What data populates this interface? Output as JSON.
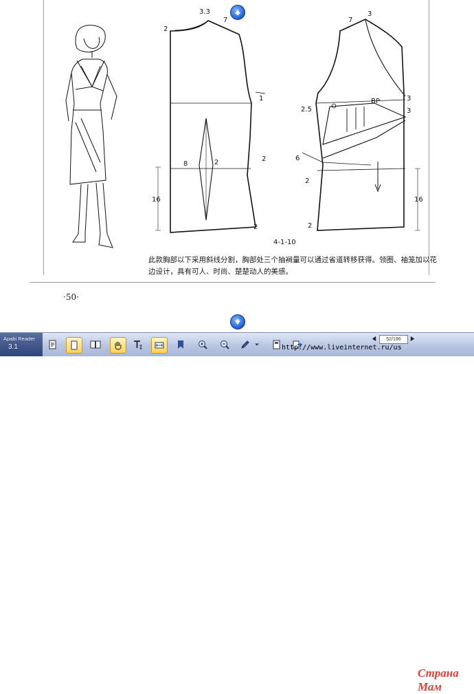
{
  "document": {
    "figure_caption": "4-1-10",
    "body_text": "此款胸部以下采用斜线分割，胸部处三个抽裥量可以通过省道转移获得。领圈、袖笼加以花边设计，具有可人、时尚、楚楚动人的美感。",
    "page_number": "·50·",
    "front_pattern_labels": {
      "neck_width": "3.3",
      "shoulder": "7",
      "neck_drop": "2",
      "armhole": "1",
      "waist_left": "8",
      "waist_dart": "2",
      "side": "2",
      "hip_depth": "16",
      "hem": "2"
    },
    "back_pattern_labels": {
      "shoulder": "7",
      "neck": "3",
      "bp": "BP",
      "apex_top": "3",
      "apex_bottom": "3",
      "offset": "2.5",
      "diagonal": "6",
      "side": "2",
      "hip_depth": "16",
      "hem": "2"
    }
  },
  "toolbar": {
    "app_name": "Apabi Reader",
    "app_version": "3.1",
    "url": "http://www.liveinternet.ru/us",
    "page_field": "52/196",
    "watermark": "Страна Мам",
    "buttons": [
      {
        "name": "open-file-icon"
      },
      {
        "name": "single-page-icon",
        "active": true
      },
      {
        "name": "two-page-icon"
      },
      {
        "name": "hand-tool-icon",
        "active": true
      },
      {
        "name": "text-select-icon"
      },
      {
        "name": "fit-width-icon",
        "active": true
      },
      {
        "name": "bookmark-icon"
      },
      {
        "name": "zoom-in-icon"
      },
      {
        "name": "zoom-out-icon"
      },
      {
        "name": "pen-icon"
      },
      {
        "name": "annotation-icon"
      },
      {
        "name": "export-icon"
      }
    ]
  }
}
